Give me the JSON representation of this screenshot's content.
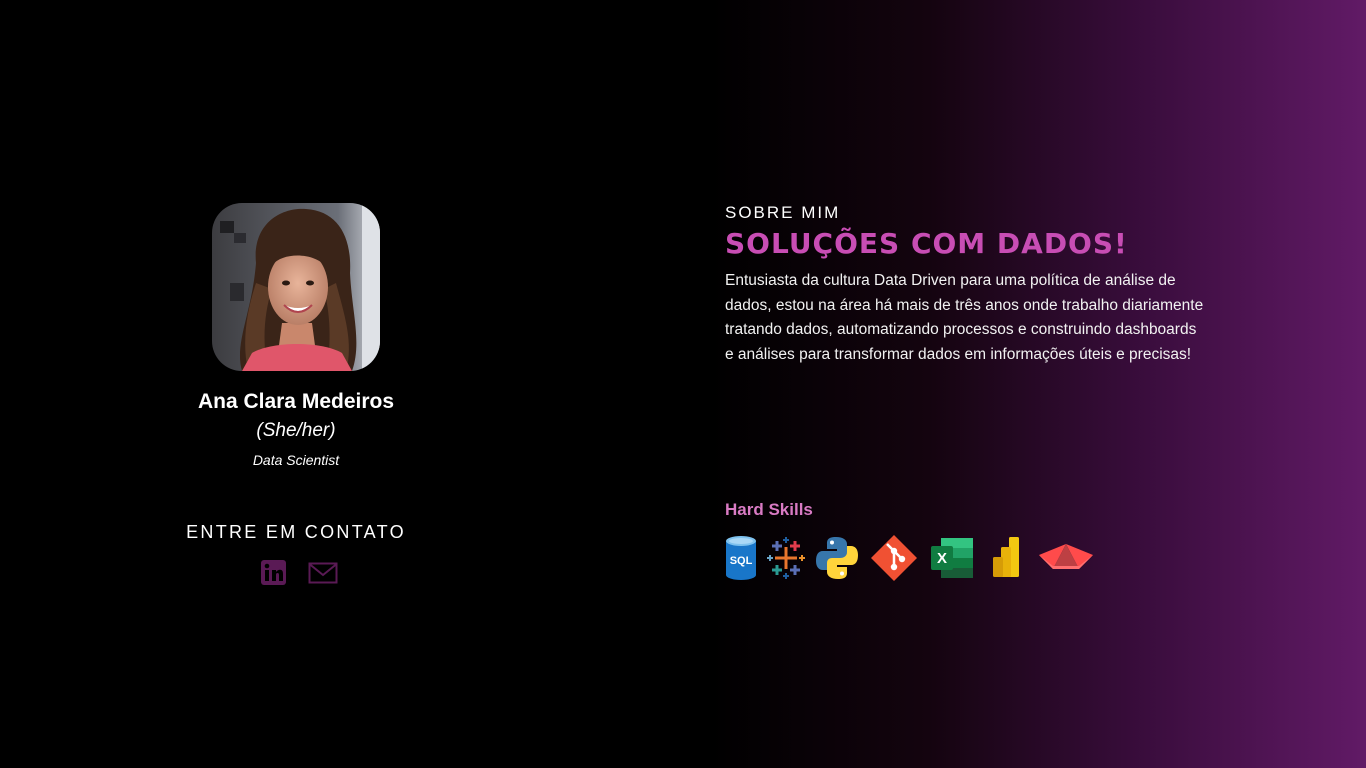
{
  "profile": {
    "name": "Ana Clara Medeiros",
    "pronouns": "(She/her)",
    "role": "Data Scientist",
    "avatar_icon": "profile-photo"
  },
  "contact": {
    "title": "ENTRE EM CONTATO",
    "links": [
      {
        "icon": "linkedin-icon"
      },
      {
        "icon": "email-icon"
      }
    ],
    "icon_color": "#5a1a55"
  },
  "about": {
    "kicker": "SOBRE MIM",
    "title": "Soluções com dados!",
    "text": "Entusiasta da cultura Data Driven para uma política de análise de dados, estou na área há mais de três anos onde trabalho diariamente tratando dados, automatizando processos e construindo dashboards e análises para transformar dados em informações úteis e precisas!",
    "accent_color": "#c84db4"
  },
  "skills": {
    "title": "Hard Skills",
    "icons": [
      "sql-database-icon",
      "tableau-icon",
      "python-icon",
      "git-icon",
      "excel-icon",
      "power-bi-icon",
      "streamlit-icon"
    ],
    "sql_label": "SQL",
    "excel_label": "X"
  }
}
